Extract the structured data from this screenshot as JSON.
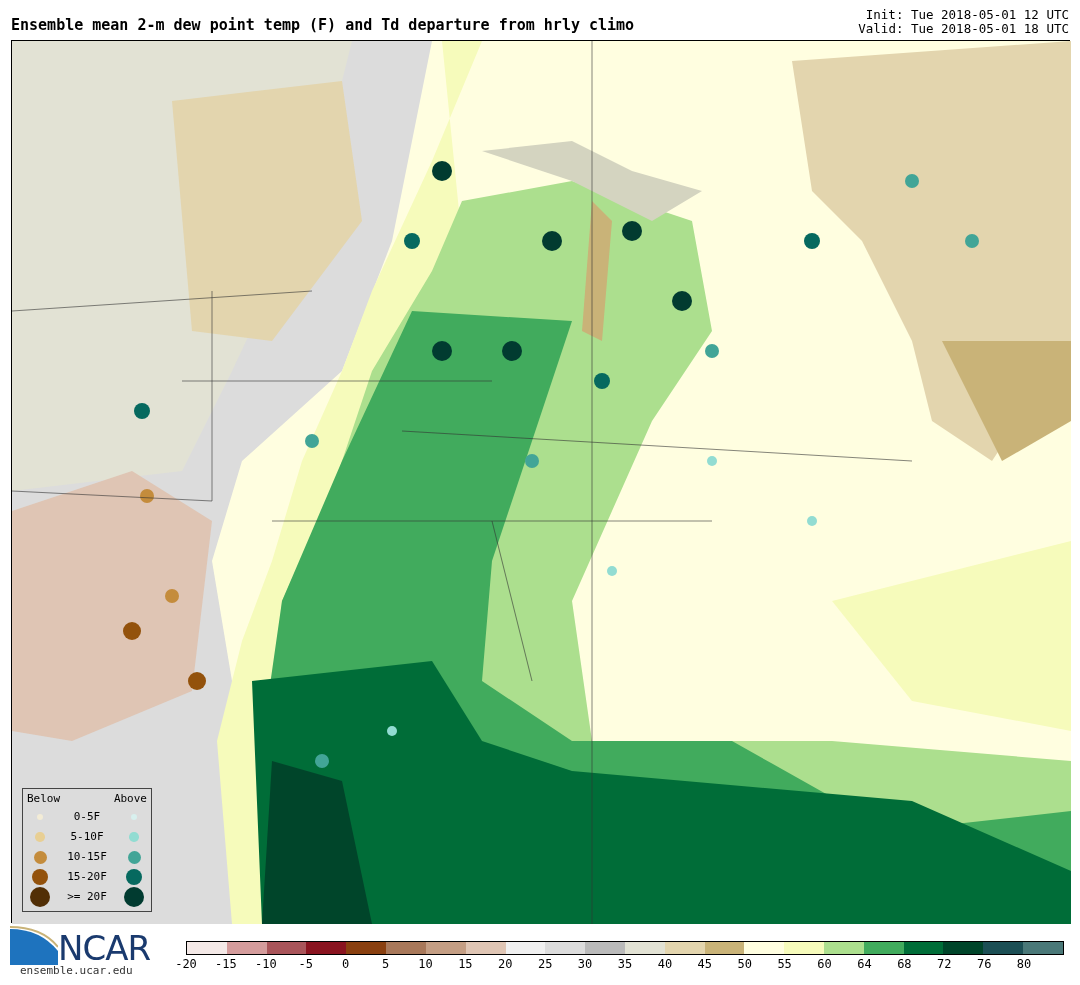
{
  "title": "Ensemble mean 2-m dew point temp (F) and Td departure from hrly climo",
  "init": "Init: Tue 2018-05-01 12 UTC",
  "valid": "Valid: Tue 2018-05-01 18 UTC",
  "legend": {
    "below_heading": "Below",
    "above_heading": "Above",
    "rows": [
      {
        "label": "0-5F",
        "below": {
          "color": "#f3ecd6"
        },
        "above": {
          "color": "#d8f0ee"
        }
      },
      {
        "label": "5-10F",
        "below": {
          "color": "#e8cf94"
        },
        "above": {
          "color": "#92dcd2"
        }
      },
      {
        "label": "10-15F",
        "below": {
          "color": "#c48c3c"
        },
        "above": {
          "color": "#42a597"
        }
      },
      {
        "label": "15-20F",
        "below": {
          "color": "#93520c"
        },
        "above": {
          "color": "#06695f"
        }
      },
      {
        "label": ">= 20F",
        "below": {
          "color": "#522f06"
        },
        "above": {
          "color": "#013b30"
        }
      }
    ]
  },
  "logo": {
    "text": "NCAR",
    "url": "ensemble.ucar.edu"
  },
  "colorbar": {
    "swatches": [
      {
        "color": "#f4e9e7"
      },
      {
        "color": "#d49c9c"
      },
      {
        "color": "#a9555a"
      },
      {
        "color": "#8a1420"
      },
      {
        "color": "#8a4010"
      },
      {
        "color": "#a8785a"
      },
      {
        "color": "#c49e84"
      },
      {
        "color": "#dfc5b4"
      },
      {
        "color": "#f0f0f0"
      },
      {
        "color": "#dcdcdc"
      },
      {
        "color": "#bababa"
      },
      {
        "color": "#e2e2d4"
      },
      {
        "color": "#e3d5ae"
      },
      {
        "color": "#c9b378"
      },
      {
        "color": "#fffee0"
      },
      {
        "color": "#f6fbbb"
      },
      {
        "color": "#acdf8e"
      },
      {
        "color": "#41ab5d"
      },
      {
        "color": "#006d38"
      },
      {
        "color": "#00452a"
      },
      {
        "color": "#1c4f55"
      },
      {
        "color": "#4a7878"
      }
    ],
    "ticks": [
      "-20",
      "-15",
      "-10",
      "-5",
      "0",
      "5",
      "10",
      "15",
      "20",
      "25",
      "30",
      "35",
      "40",
      "45",
      "50",
      "55",
      "60",
      "64",
      "68",
      "72",
      "76",
      "80"
    ]
  }
}
